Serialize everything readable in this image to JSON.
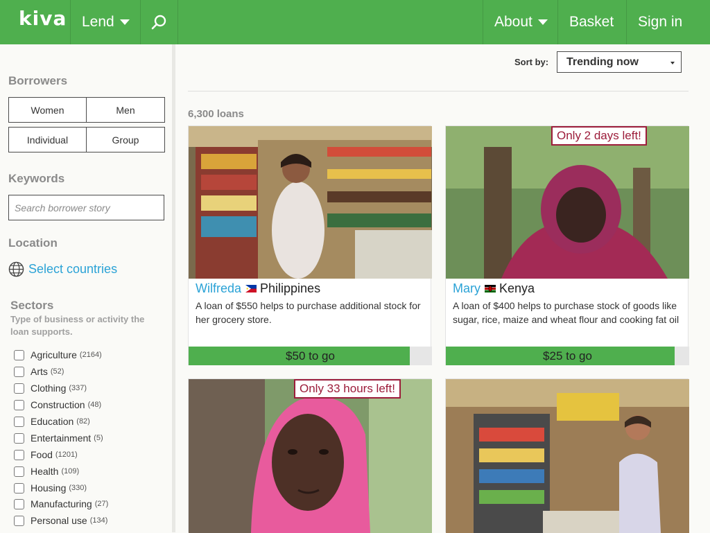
{
  "header": {
    "logo": "kiva",
    "lend_label": "Lend",
    "about_label": "About",
    "basket_label": "Basket",
    "signin_label": "Sign in",
    "brand_color": "#4faf4e"
  },
  "sidebar": {
    "borrowers_heading": "Borrowers",
    "gender": [
      "Women",
      "Men"
    ],
    "type": [
      "Individual",
      "Group"
    ],
    "keywords_heading": "Keywords",
    "search_placeholder": "Search borrower story",
    "location_heading": "Location",
    "location_link": "Select countries",
    "sectors_heading": "Sectors",
    "sectors_desc": "Type of business or activity the loan supports.",
    "sectors": [
      {
        "label": "Agriculture",
        "count": "(2164)"
      },
      {
        "label": "Arts",
        "count": "(52)"
      },
      {
        "label": "Clothing",
        "count": "(337)"
      },
      {
        "label": "Construction",
        "count": "(48)"
      },
      {
        "label": "Education",
        "count": "(82)"
      },
      {
        "label": "Entertainment",
        "count": "(5)"
      },
      {
        "label": "Food",
        "count": "(1201)"
      },
      {
        "label": "Health",
        "count": "(109)"
      },
      {
        "label": "Housing",
        "count": "(330)"
      },
      {
        "label": "Manufacturing",
        "count": "(27)"
      },
      {
        "label": "Personal use",
        "count": "(134)"
      }
    ]
  },
  "main": {
    "sort_label": "Sort by:",
    "sort_value": "Trending now",
    "loan_count": "6,300 loans",
    "cards": [
      {
        "name": "Wilfreda",
        "country": "Philippines",
        "desc": "A loan of $550 helps to purchase additional stock for her grocery store.",
        "progress_label": "$50 to go",
        "progress": 0.91,
        "badge": ""
      },
      {
        "name": "Mary",
        "country": "Kenya",
        "desc": "A loan of $400 helps to purchase stock of goods like sugar, rice, maize and wheat flour and cooking fat oil",
        "progress_label": "$25 to go",
        "progress": 0.94,
        "badge": "Only 2 days left!"
      },
      {
        "name": "",
        "country": "",
        "desc": "",
        "progress_label": "",
        "progress": 0,
        "badge": "Only 33 hours left!"
      },
      {
        "name": "",
        "country": "",
        "desc": "",
        "progress_label": "",
        "progress": 0,
        "badge": ""
      }
    ]
  }
}
